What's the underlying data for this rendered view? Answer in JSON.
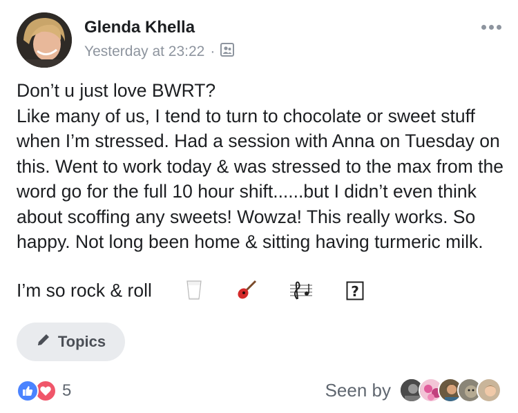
{
  "post": {
    "author": "Glenda Khella",
    "timestamp": "Yesterday at 23:22",
    "separator": "·",
    "audience_icon": "friends-icon",
    "paragraphs": [
      "Don’t u just love BWRT?",
      "Like many of us, I tend to turn to chocolate or sweet stuff when I’m stressed. Had a session with Anna on Tuesday on this. Went to work today & was stressed to the max from the word go for the full 10 hour shift......but I didn’t even think about scoffing any sweets! Wowza! This really works. So happy. Not long been home & sitting having turmeric milk. I’m so rock & roll"
    ],
    "emojis": [
      "milk-glass-emoji",
      "guitar-emoji",
      "musical-score-emoji",
      "unknown-glyph"
    ],
    "unknown_glyph": "?"
  },
  "topics": {
    "label": "Topics",
    "icon": "pencil-icon"
  },
  "footer": {
    "reaction_count": "5",
    "reactions": [
      "like",
      "love"
    ],
    "seen_label": "Seen by",
    "viewer_count": 5
  },
  "colors": {
    "like": "#4a83ff",
    "love": "#f0566a",
    "secondary_text": "#8d949e",
    "chip_background": "#e9ebee"
  }
}
